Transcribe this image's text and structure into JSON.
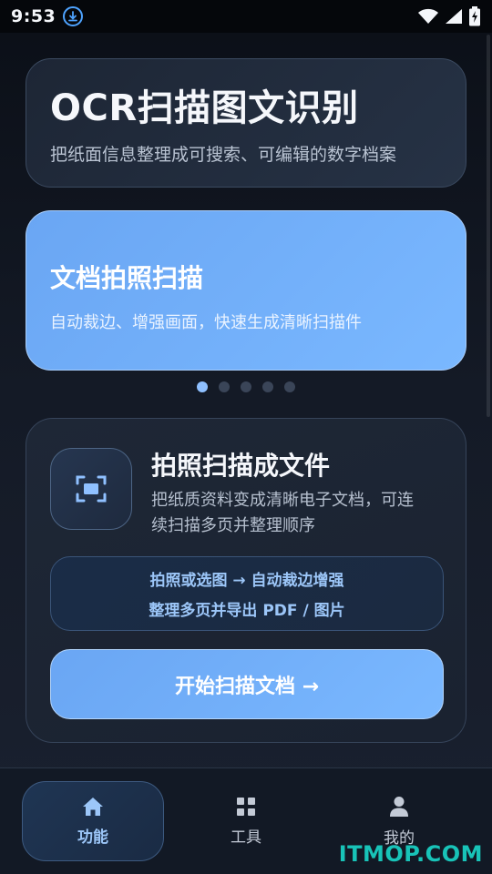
{
  "status_bar": {
    "time": "9:53",
    "icons": [
      "download-icon",
      "wifi-icon",
      "signal-icon",
      "battery-charging-icon"
    ]
  },
  "hero": {
    "title": "OCR扫描图文识别",
    "subtitle": "把纸面信息整理成可搜索、可编辑的数字档案"
  },
  "banner": {
    "title": "文档拍照扫描",
    "subtitle": "自动裁边、增强画面，快速生成清晰扫描件",
    "active_index": 0,
    "total": 5
  },
  "feature": {
    "icon": "scan-frame-icon",
    "title": "拍照扫描成文件",
    "desc_line1": "把纸质资料变成清晰电子文档，可连",
    "desc_line2": "续扫描多页并整理顺序",
    "steps_line1": "拍照或选图 → 自动裁边增强",
    "steps_line2": "整理多页并导出 PDF / 图片",
    "button_label": "开始扫描文档 →"
  },
  "nav": {
    "items": [
      {
        "label": "功能",
        "icon": "home-icon",
        "active": true
      },
      {
        "label": "工具",
        "icon": "grid-icon",
        "active": false
      },
      {
        "label": "我的",
        "icon": "person-icon",
        "active": false
      }
    ]
  },
  "watermark": "ITMOP.COM",
  "colors": {
    "accent": "#7ab8ff",
    "accent_text": "#9cc6f8",
    "background": "#141a26"
  }
}
